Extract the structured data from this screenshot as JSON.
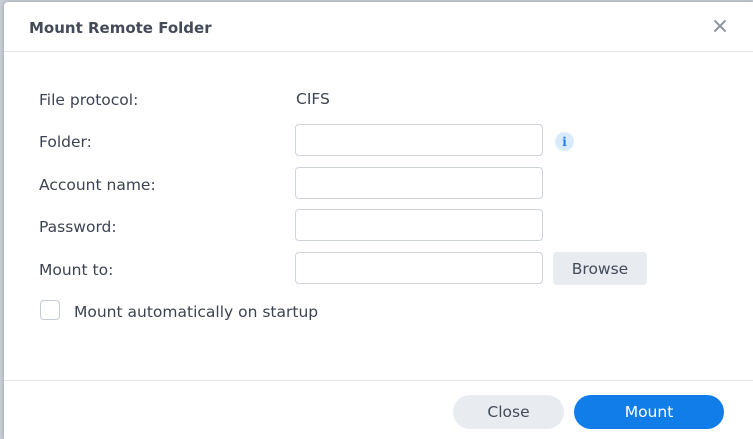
{
  "dialog": {
    "title": "Mount Remote Folder"
  },
  "form": {
    "file_protocol_label": "File protocol:",
    "file_protocol_value": "CIFS",
    "folder_label": "Folder:",
    "folder_value": "",
    "account_label": "Account name:",
    "account_value": "",
    "password_label": "Password:",
    "password_value": "",
    "mount_to_label": "Mount to:",
    "mount_to_value": "",
    "browse_label": "Browse",
    "auto_mount_label": "Mount automatically on startup",
    "auto_mount_checked": false
  },
  "footer": {
    "close_label": "Close",
    "mount_label": "Mount"
  },
  "colors": {
    "primary": "#117de8",
    "secondary_button": "#e8ecf1",
    "info_icon": "#1a7fe0"
  },
  "icons": {
    "close": "close-icon",
    "info": "info-icon"
  }
}
